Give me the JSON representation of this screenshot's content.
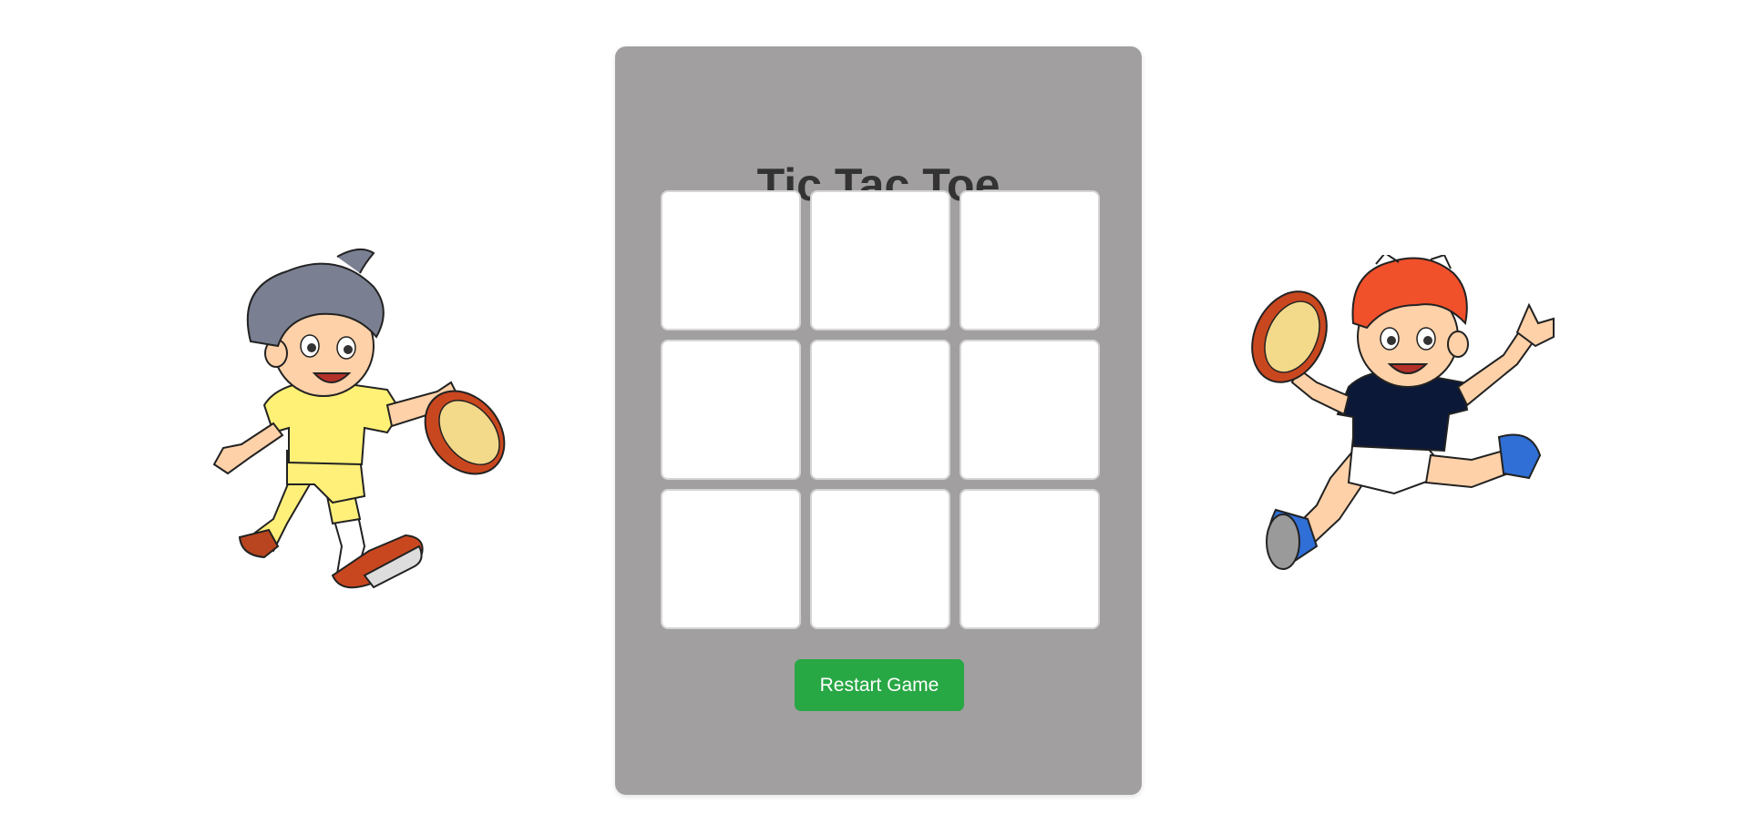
{
  "game": {
    "title": "Tic Tac Toe",
    "board": [
      "",
      "",
      "",
      "",
      "",
      "",
      "",
      "",
      ""
    ],
    "restart_label": "Restart Game"
  },
  "illustrations": {
    "left": {
      "icon": "rugby-player-yellow-shirt-icon"
    },
    "right": {
      "icon": "rugby-player-navy-shirt-icon"
    }
  },
  "colors": {
    "card_background": "#a19fa0",
    "title_text": "#333333",
    "cell_background": "#ffffff",
    "cell_border": "#d5d5d5",
    "restart_button": "#28a745"
  }
}
